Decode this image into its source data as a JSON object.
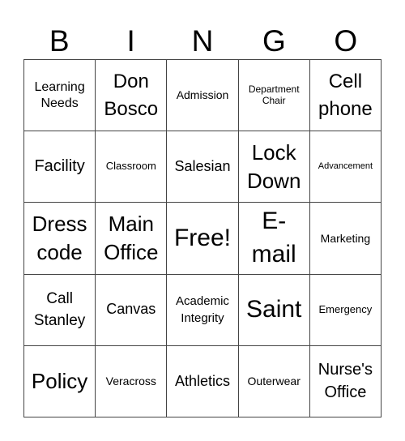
{
  "header": {
    "letters": [
      "B",
      "I",
      "N",
      "G",
      "O"
    ]
  },
  "board": {
    "rows": [
      [
        "Learning Needs",
        "Don Bosco",
        "Admission",
        "Department Chair",
        "Cell phone"
      ],
      [
        "Facility",
        "Classroom",
        "Salesian",
        "Lock Down",
        "Advancement"
      ],
      [
        "Dress code",
        "Main Office",
        "Free!",
        "E-mail",
        "Marketing"
      ],
      [
        "Call Stanley",
        "Canvas",
        "Academic Integrity",
        "Saint",
        "Emergency"
      ],
      [
        "Policy",
        "Veracross",
        "Athletics",
        "Outerwear",
        "Nurse's Office"
      ]
    ]
  }
}
